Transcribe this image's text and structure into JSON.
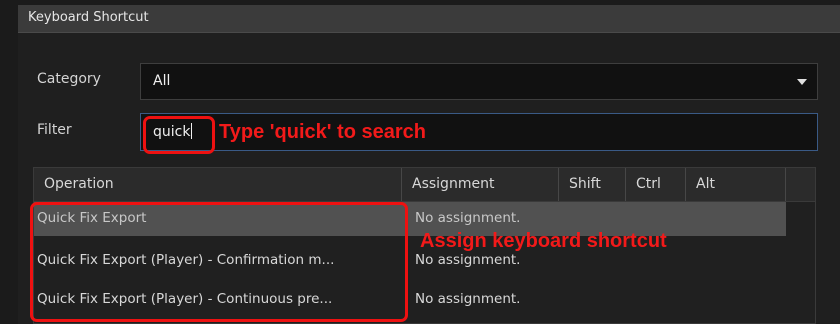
{
  "window": {
    "title": "Keyboard Shortcut"
  },
  "category": {
    "label": "Category",
    "value": "All"
  },
  "filter": {
    "label": "Filter",
    "value": "quick"
  },
  "table": {
    "columns": [
      "Operation",
      "Assignment",
      "Shift",
      "Ctrl",
      "Alt"
    ],
    "rows": [
      {
        "operation": "Quick Fix Export",
        "assignment": "No assignment."
      },
      {
        "operation": "Quick Fix Export (Player) - Confirmation m...",
        "assignment": "No assignment."
      },
      {
        "operation": "Quick Fix Export (Player) - Continuous pre...",
        "assignment": "No assignment."
      }
    ]
  },
  "annotations": {
    "search_hint": "Type 'quick' to search",
    "assign_hint": "Assign keyboard shortcut"
  },
  "colors": {
    "annotation": "#f21a1a",
    "selected_row": "#515151",
    "background": "#1b1b1b"
  }
}
